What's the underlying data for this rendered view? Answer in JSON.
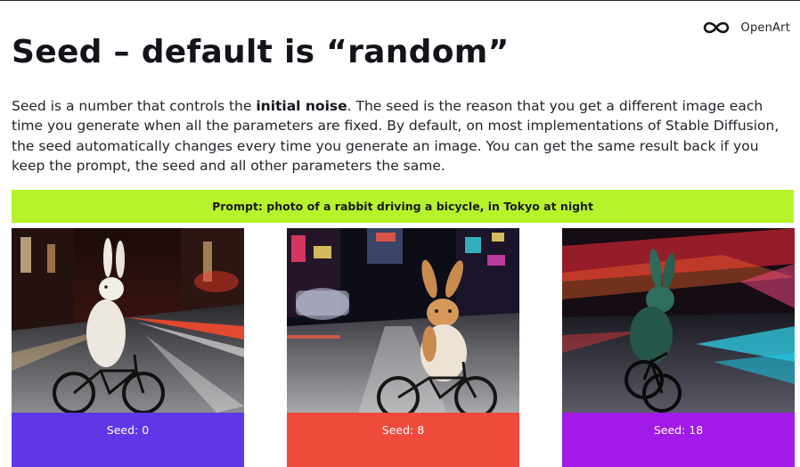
{
  "brand": {
    "name": "OpenArt",
    "logo_icon": "infinity-icon"
  },
  "heading": "Seed – default is “random”",
  "intro": {
    "before": "Seed is a number that controls the ",
    "bold": "initial noise",
    "after": ". The seed is the reason that you get a different image each time you generate when all the parameters are fixed. By default, on most implementations of Stable Diffusion, the seed automatically changes every time you generate an image. You can get the same result back if you keep the prompt, the seed and all other parameters the same."
  },
  "prompt_bar": {
    "text": "Prompt: photo of a rabbit driving a bicycle, in Tokyo at night",
    "color": "#b7f32b"
  },
  "cards": [
    {
      "seed_label": "Seed: 0",
      "color": "#6036e6"
    },
    {
      "seed_label": "Seed: 8",
      "color": "#f04a3c"
    },
    {
      "seed_label": "Seed: 18",
      "color": "#a11ae8"
    }
  ]
}
